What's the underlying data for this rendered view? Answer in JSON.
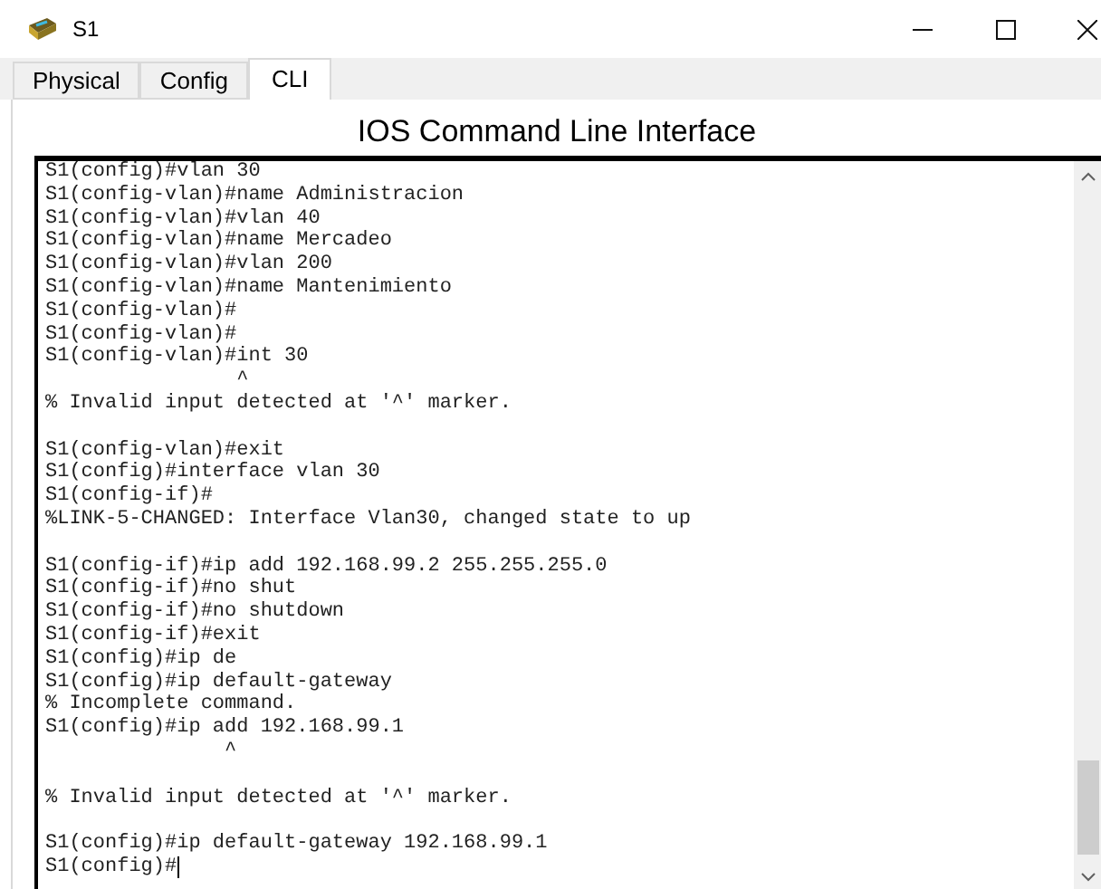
{
  "window": {
    "title": "S1"
  },
  "tabs": [
    {
      "label": "Physical",
      "selected": false
    },
    {
      "label": "Config",
      "selected": false
    },
    {
      "label": "CLI",
      "selected": true
    }
  ],
  "heading": "IOS Command Line Interface",
  "terminal": {
    "lines": [
      {
        "kind": "text",
        "text": "S1(config)#vlan 30"
      },
      {
        "kind": "text",
        "text": "S1(config-vlan)#name Administracion"
      },
      {
        "kind": "text",
        "text": "S1(config-vlan)#vlan 40"
      },
      {
        "kind": "text",
        "text": "S1(config-vlan)#name Mercadeo"
      },
      {
        "kind": "text",
        "text": "S1(config-vlan)#vlan 200"
      },
      {
        "kind": "text",
        "text": "S1(config-vlan)#name Mantenimiento"
      },
      {
        "kind": "text",
        "text": "S1(config-vlan)#"
      },
      {
        "kind": "text",
        "text": "S1(config-vlan)#"
      },
      {
        "kind": "text",
        "text": "S1(config-vlan)#int 30"
      },
      {
        "kind": "text",
        "text": "                ^"
      },
      {
        "kind": "text",
        "text": "% Invalid input detected at '^' marker."
      },
      {
        "kind": "blank"
      },
      {
        "kind": "text",
        "text": "S1(config-vlan)#exit"
      },
      {
        "kind": "text",
        "text": "S1(config)#interface vlan 30"
      },
      {
        "kind": "text",
        "text": "S1(config-if)#"
      },
      {
        "kind": "text",
        "text": "%LINK-5-CHANGED: Interface Vlan30, changed state to up"
      },
      {
        "kind": "blank"
      },
      {
        "kind": "text",
        "text": "S1(config-if)#ip add 192.168.99.2 255.255.255.0"
      },
      {
        "kind": "text",
        "text": "S1(config-if)#no shut"
      },
      {
        "kind": "text",
        "text": "S1(config-if)#no shutdown"
      },
      {
        "kind": "text",
        "text": "S1(config-if)#exit"
      },
      {
        "kind": "text",
        "text": "S1(config)#ip de"
      },
      {
        "kind": "text",
        "text": "S1(config)#ip default-gateway"
      },
      {
        "kind": "text",
        "text": "% Incomplete command."
      },
      {
        "kind": "text",
        "text": "S1(config)#ip add 192.168.99.1"
      },
      {
        "kind": "text",
        "text": "               ^"
      },
      {
        "kind": "blank"
      },
      {
        "kind": "text",
        "text": "% Invalid input detected at '^' marker."
      },
      {
        "kind": "blank"
      },
      {
        "kind": "text",
        "text": "S1(config)#ip default-gateway 192.168.99.1"
      },
      {
        "kind": "prompt",
        "text": "S1(config)#"
      }
    ]
  }
}
